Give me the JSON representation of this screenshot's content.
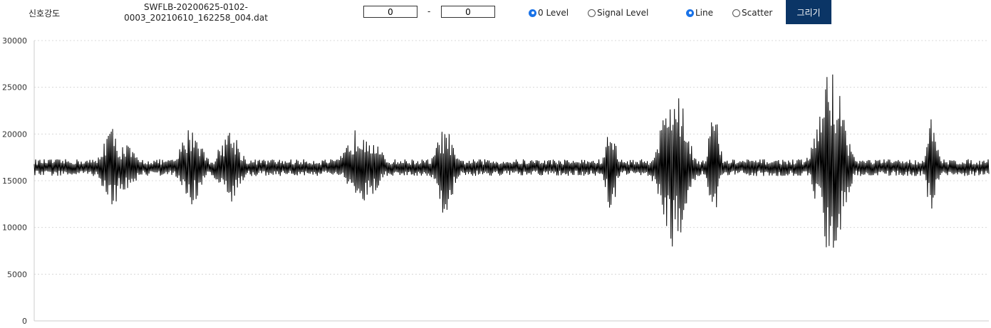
{
  "toolbar": {
    "title": "신호강도",
    "filename_line1": "SWFLB-20200625-0102-",
    "filename_line2": "0003_20210610_162258_004.dat",
    "range_start": "0",
    "range_separator": "-",
    "range_end": "0",
    "level_options": [
      {
        "label": "0 Level",
        "checked": true
      },
      {
        "label": "Signal Level",
        "checked": false
      }
    ],
    "chart_type_options": [
      {
        "label": "Line",
        "checked": true
      },
      {
        "label": "Scatter",
        "checked": false
      }
    ],
    "draw_button_label": "그리기",
    "draw_button_color": "#0b3566"
  },
  "chart_data": {
    "type": "line",
    "title": "",
    "xlabel": "",
    "ylabel": "",
    "ylim": [
      0,
      30000
    ],
    "yticks": [
      "0",
      "5000",
      "10000",
      "15000",
      "20000",
      "25000",
      "30000"
    ],
    "grid": "horizontal dotted",
    "line_color": "#000000",
    "baseline": 16400,
    "noise_amplitude": 900,
    "samples": 1340,
    "bursts": [
      {
        "center": 0.08,
        "width": 0.008,
        "max": 20900,
        "min": 11600
      },
      {
        "center": 0.095,
        "width": 0.01,
        "max": 19000,
        "min": 13500
      },
      {
        "center": 0.165,
        "width": 0.01,
        "max": 21000,
        "min": 12400
      },
      {
        "center": 0.205,
        "width": 0.01,
        "max": 20600,
        "min": 12200
      },
      {
        "center": 0.344,
        "width": 0.014,
        "max": 21200,
        "min": 12400
      },
      {
        "center": 0.43,
        "width": 0.008,
        "max": 20700,
        "min": 11200
      },
      {
        "center": 0.604,
        "width": 0.005,
        "max": 20900,
        "min": 11500
      },
      {
        "center": 0.67,
        "width": 0.012,
        "max": 25200,
        "min": 7800
      },
      {
        "center": 0.712,
        "width": 0.005,
        "max": 22700,
        "min": 10400
      },
      {
        "center": 0.835,
        "width": 0.012,
        "max": 27200,
        "min": 6900
      },
      {
        "center": 0.94,
        "width": 0.005,
        "max": 21800,
        "min": 11100
      }
    ]
  }
}
